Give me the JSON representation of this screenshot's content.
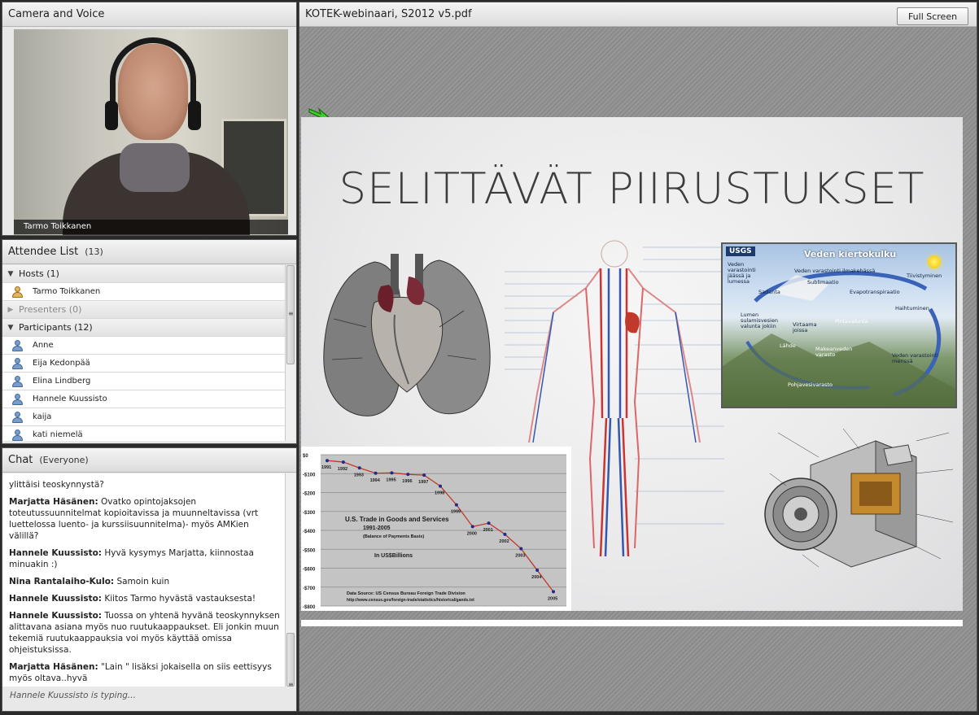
{
  "camera": {
    "title": "Camera and Voice",
    "presenter_name": "Tarmo Toikkanen"
  },
  "attendees": {
    "title": "Attendee List",
    "count": "(13)",
    "groups": {
      "hosts": "Hosts (1)",
      "presenters": "Presenters (0)",
      "participants": "Participants (12)"
    },
    "hosts": [
      "Tarmo Toikkanen"
    ],
    "participants": [
      "Anne",
      "Eija Kedonpää",
      "Elina Lindberg",
      "Hannele Kuussisto",
      "kaija",
      "kati niemelä"
    ]
  },
  "chat": {
    "title": "Chat",
    "scope": "(Everyone)",
    "partial_first": "ylittäisi teoskynnystä?",
    "messages": [
      {
        "author": "Marjatta Häsänen:",
        "text": " Ovatko opintojaksojen toteutussuunnitelmat kopioitavissa ja muunneltavissa (vrt luettelossa luento- ja kurssiisuunnitelma)- myös AMKien välillä?"
      },
      {
        "author": "Hannele Kuussisto:",
        "text": " Hyvä kysymys Marjatta, kiinnostaa minuakin :)"
      },
      {
        "author": "Nina Rantalaiho-Kulo:",
        "text": " Samoin kuin"
      },
      {
        "author": "Hannele Kuussisto:",
        "text": " Kiitos Tarmo hyvästä vastauksesta!"
      },
      {
        "author": "Hannele Kuussisto:",
        "text": " Tuossa on yhtenä hyvänä teoskynnyksen alittavana asiana myös nuo ruutukaappaukset. Eli jonkin muun tekemiä ruutukaappauksia voi myös käyttää omissa ohjeistuksissa."
      },
      {
        "author": "Marjatta Häsänen:",
        "text": " \"Lain \" lisäksi jokaisella on siis eettisyys myös oltava..hyvä"
      }
    ],
    "typing": "Hannele Kuussisto is typing..."
  },
  "share": {
    "title": "KOTEK-webinaari, S2012 v5.pdf",
    "fullscreen_label": "Full Screen",
    "slide_title": "SELITTÄVÄT PIIRUSTUKSET",
    "water_cycle": {
      "logo": "USGS",
      "title": "Veden kiertokulku",
      "labels": [
        "Veden varastointi jäässä ja lumessa",
        "Veden varastointi ilmakehässä",
        "Tiivistyminen",
        "Sublimaatio",
        "Sadanta",
        "Evapotranspiraatio",
        "Haihtuminen",
        "Lumen sulamisvesien valunta jokiin",
        "Virtaama joissa",
        "Pintavalunta",
        "Lähde",
        "Makeanveden varasto",
        "Veden varastointi merissä",
        "Pohjavesivarasto"
      ]
    },
    "trade_chart": {
      "title_lines": [
        "U.S. Trade in Goods and Services",
        "1991-2005"
      ],
      "subtitle": "(Balance of Payments Basis)",
      "unit": "In US$Billions",
      "source_lines": [
        "Data Source:  US Census Bureau Foreign Trade Division",
        "http://www.census.gov/foreign-trade/statistics/historical/gands.txt"
      ]
    }
  },
  "chart_data": {
    "type": "line",
    "title": "U.S. Trade in Goods and Services 1991-2005",
    "x": [
      "1991",
      "1992",
      "1993",
      "1994",
      "1995",
      "1996",
      "1997",
      "1998",
      "1999",
      "2000",
      "2001",
      "2002",
      "2003",
      "2004",
      "2005"
    ],
    "series": [
      {
        "values": [
          -31,
          -39,
          -70,
          -98,
          -96,
          -104,
          -108,
          -166,
          -265,
          -380,
          -362,
          -421,
          -497,
          -611,
          -724
        ]
      }
    ],
    "yticks": [
      "$0",
      "-$100",
      "-$200",
      "-$300",
      "-$400",
      "-$500",
      "-$600",
      "-$700",
      "-$800"
    ],
    "ylim": [
      -800,
      0
    ],
    "colors": {
      "line": "#c0392b",
      "marker": "#1f2a8a"
    }
  }
}
